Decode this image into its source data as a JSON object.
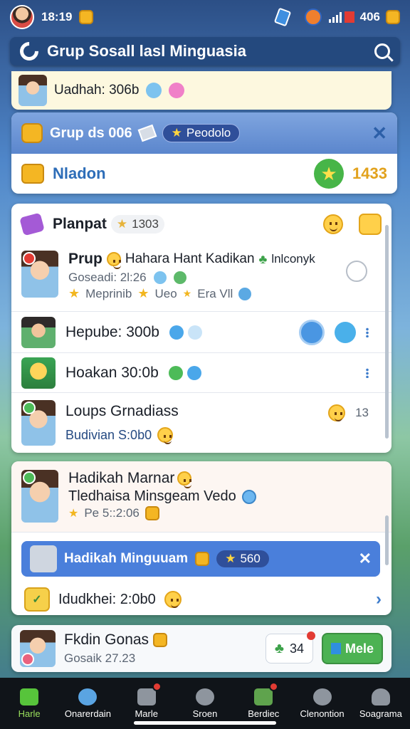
{
  "status": {
    "time": "18:19",
    "battery": "406"
  },
  "search": {
    "title": "Grup Sosall lasl Minguasia"
  },
  "top_strip": {
    "text": "Uadhah: 306b"
  },
  "group_card": {
    "title": "Grup ds 006",
    "chip_label": "Peodolo",
    "subtitle": "Nladon",
    "count": "1433"
  },
  "main_panel": {
    "header": {
      "title": "Planpat",
      "chip": "1303"
    },
    "rows": [
      {
        "name": "Prup",
        "extra": "Hahara Hant Kadikan",
        "extra2": "lnlconyk",
        "line2": "Goseadi: 2l:26",
        "line3a": "Meprinib",
        "line3b": "Ueo",
        "line3c": "Era Vll"
      },
      {
        "name": "Hepube: 300b"
      },
      {
        "name": "Hoakan 30:0b"
      },
      {
        "name": "Loups Grnadiass",
        "sub": "Budivian S:0b0",
        "right": "13"
      }
    ]
  },
  "second_panel": {
    "title": "Hadikah Marnar",
    "line2": "Tledhaisa Minsgeam Vedo",
    "line3": "Pe 5::2:06",
    "banner": {
      "title": "Hadikah Minguuam",
      "chip": "560"
    },
    "row": {
      "text": "Idudkhei: 2:0b0"
    }
  },
  "bottom_card": {
    "title": "Fkdin Gonas",
    "sub": "Gosaik 27.23",
    "count": "34",
    "button": "Mele"
  },
  "nav": [
    {
      "label": "Harle"
    },
    {
      "label": "Onarerdain"
    },
    {
      "label": "Marle"
    },
    {
      "label": "Sroen"
    },
    {
      "label": "Berdiec"
    },
    {
      "label": "Clenontion"
    },
    {
      "label": "Soagrama"
    }
  ]
}
